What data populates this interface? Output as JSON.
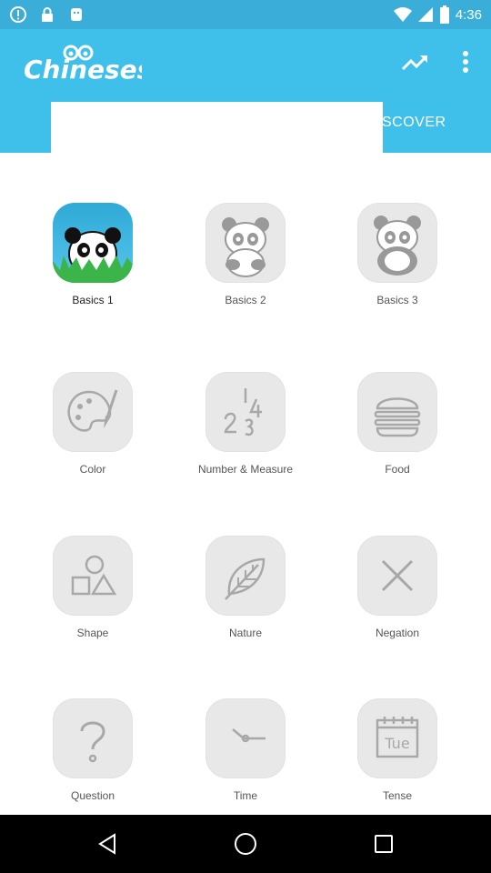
{
  "status_bar": {
    "time": "4:36",
    "icons": [
      "alert-circle-icon",
      "lock-icon",
      "android-icon",
      "wifi-icon",
      "signal-icon",
      "battery-icon"
    ]
  },
  "app_bar": {
    "logo_text": "Chineseskill",
    "trend_icon": "trending-up-icon",
    "more_icon": "more-vertical-icon",
    "tab_discover": "SCOVER"
  },
  "lessons": [
    {
      "label": "Basics 1",
      "icon": "panda-grass-icon",
      "active": true
    },
    {
      "label": "Basics 2",
      "icon": "panda-sitting-icon",
      "active": false
    },
    {
      "label": "Basics 3",
      "icon": "panda-standing-icon",
      "active": false
    },
    {
      "label": "Color",
      "icon": "palette-icon",
      "active": false
    },
    {
      "label": "Number & Measure",
      "icon": "numbers-icon",
      "active": false
    },
    {
      "label": "Food",
      "icon": "burger-icon",
      "active": false
    },
    {
      "label": "Shape",
      "icon": "shapes-icon",
      "active": false
    },
    {
      "label": "Nature",
      "icon": "leaf-icon",
      "active": false
    },
    {
      "label": "Negation",
      "icon": "x-mark-icon",
      "active": false
    },
    {
      "label": "Question",
      "icon": "question-mark-icon",
      "active": false
    },
    {
      "label": "Time",
      "icon": "clock-hands-icon",
      "active": false
    },
    {
      "label": "Tense",
      "icon": "calendar-icon",
      "active": false
    },
    {
      "calendar_day": "Tue"
    }
  ],
  "colors": {
    "status_bar": "#3aaed8",
    "app_bar": "#3ec0ea",
    "badge_gray": "#e8e8e8",
    "icon_gray": "#a8a8a8"
  },
  "nav_bar": {
    "back_icon": "back-triangle-icon",
    "home_icon": "home-circle-icon",
    "recents_icon": "recents-square-icon"
  }
}
